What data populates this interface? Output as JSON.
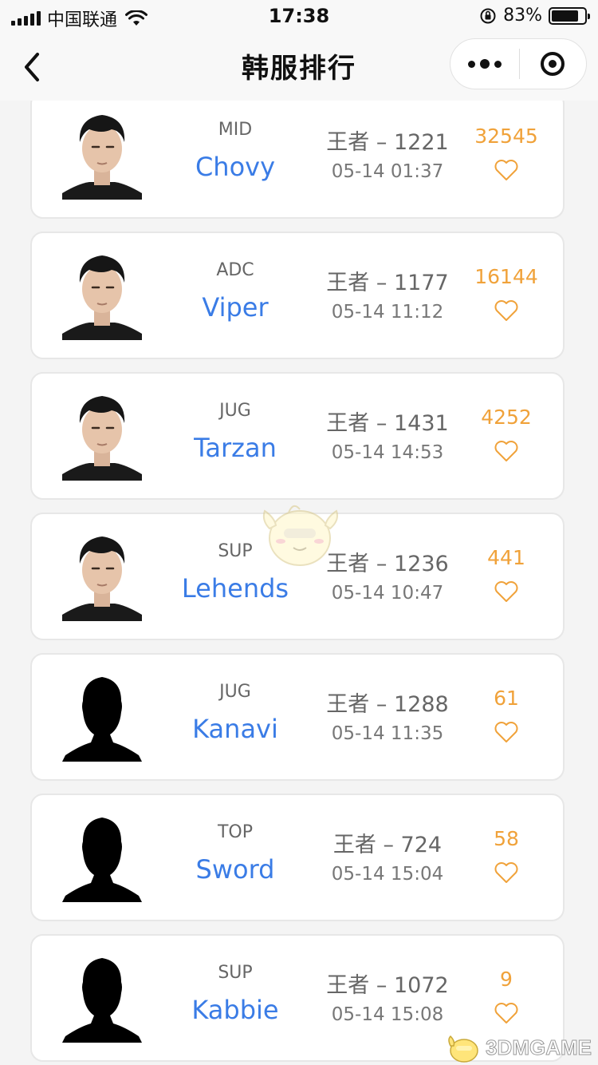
{
  "status_bar": {
    "carrier": "中国联通",
    "time": "17:38",
    "battery_percent": "83%",
    "battery_level": 0.83
  },
  "nav": {
    "title": "韩服排行",
    "back_icon": "chevron-left-icon",
    "more_icon": "more-dots-icon",
    "close_icon": "target-close-icon"
  },
  "players": [
    {
      "role": "MID",
      "name": "Chovy",
      "rank": "王者 – 1221",
      "time": "05-14 01:37",
      "likes": "32545",
      "avatar": "photo"
    },
    {
      "role": "ADC",
      "name": "Viper",
      "rank": "王者 – 1177",
      "time": "05-14 11:12",
      "likes": "16144",
      "avatar": "photo"
    },
    {
      "role": "JUG",
      "name": "Tarzan",
      "rank": "王者 – 1431",
      "time": "05-14 14:53",
      "likes": "4252",
      "avatar": "photo"
    },
    {
      "role": "SUP",
      "name": "Lehends",
      "rank": "王者 – 1236",
      "time": "05-14 10:47",
      "likes": "441",
      "avatar": "photo"
    },
    {
      "role": "JUG",
      "name": "Kanavi",
      "rank": "王者 – 1288",
      "time": "05-14 11:35",
      "likes": "61",
      "avatar": "silhouette"
    },
    {
      "role": "TOP",
      "name": "Sword",
      "rank": "王者 – 724",
      "time": "05-14 15:04",
      "likes": "58",
      "avatar": "silhouette"
    },
    {
      "role": "SUP",
      "name": "Kabbie",
      "rank": "王者 – 1072",
      "time": "05-14 15:08",
      "likes": "9",
      "avatar": "silhouette"
    }
  ],
  "watermark": {
    "text": "3DMGAME"
  },
  "colors": {
    "name": "#3a7ce6",
    "likes": "#f0a23a",
    "heart": "#f0a23a"
  }
}
